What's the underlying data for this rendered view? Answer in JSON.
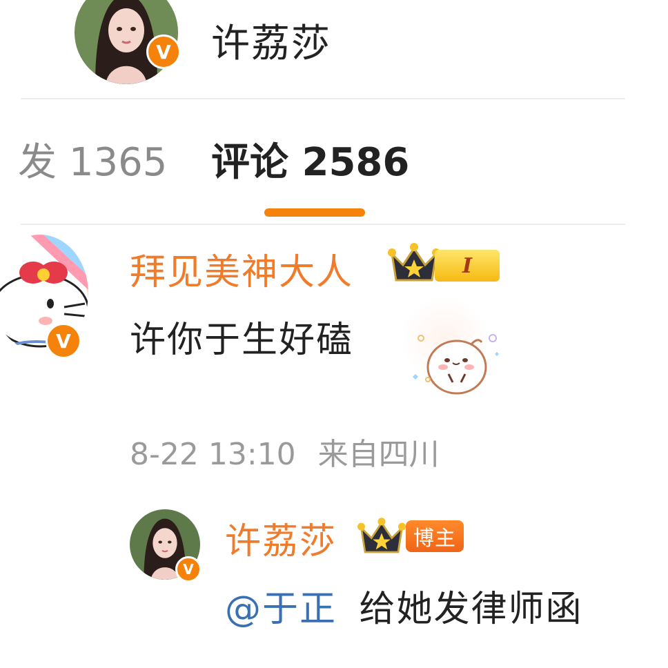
{
  "profile": {
    "name": "许荔莎",
    "verified_badge": "V"
  },
  "tabs": [
    {
      "label": "发",
      "count": "1365",
      "active": false
    },
    {
      "label": "评论",
      "count": "2586",
      "active": true
    }
  ],
  "comment": {
    "user_name": "拜见美神大人",
    "verified_badge": "V",
    "level_badge": "I",
    "text": "许你于生好磕",
    "sticker_icon": "blushing-bun-sticker",
    "timestamp": "8-22 13:10",
    "location": "来自四川",
    "reply": {
      "user_name": "许荔莎",
      "verified_badge": "V",
      "role_badge": "博主",
      "mention": "@于正",
      "text": "给她发律师函"
    }
  },
  "colors": {
    "accent": "#f5820a",
    "username": "#f07b2a",
    "mention": "#3a6fb0"
  }
}
